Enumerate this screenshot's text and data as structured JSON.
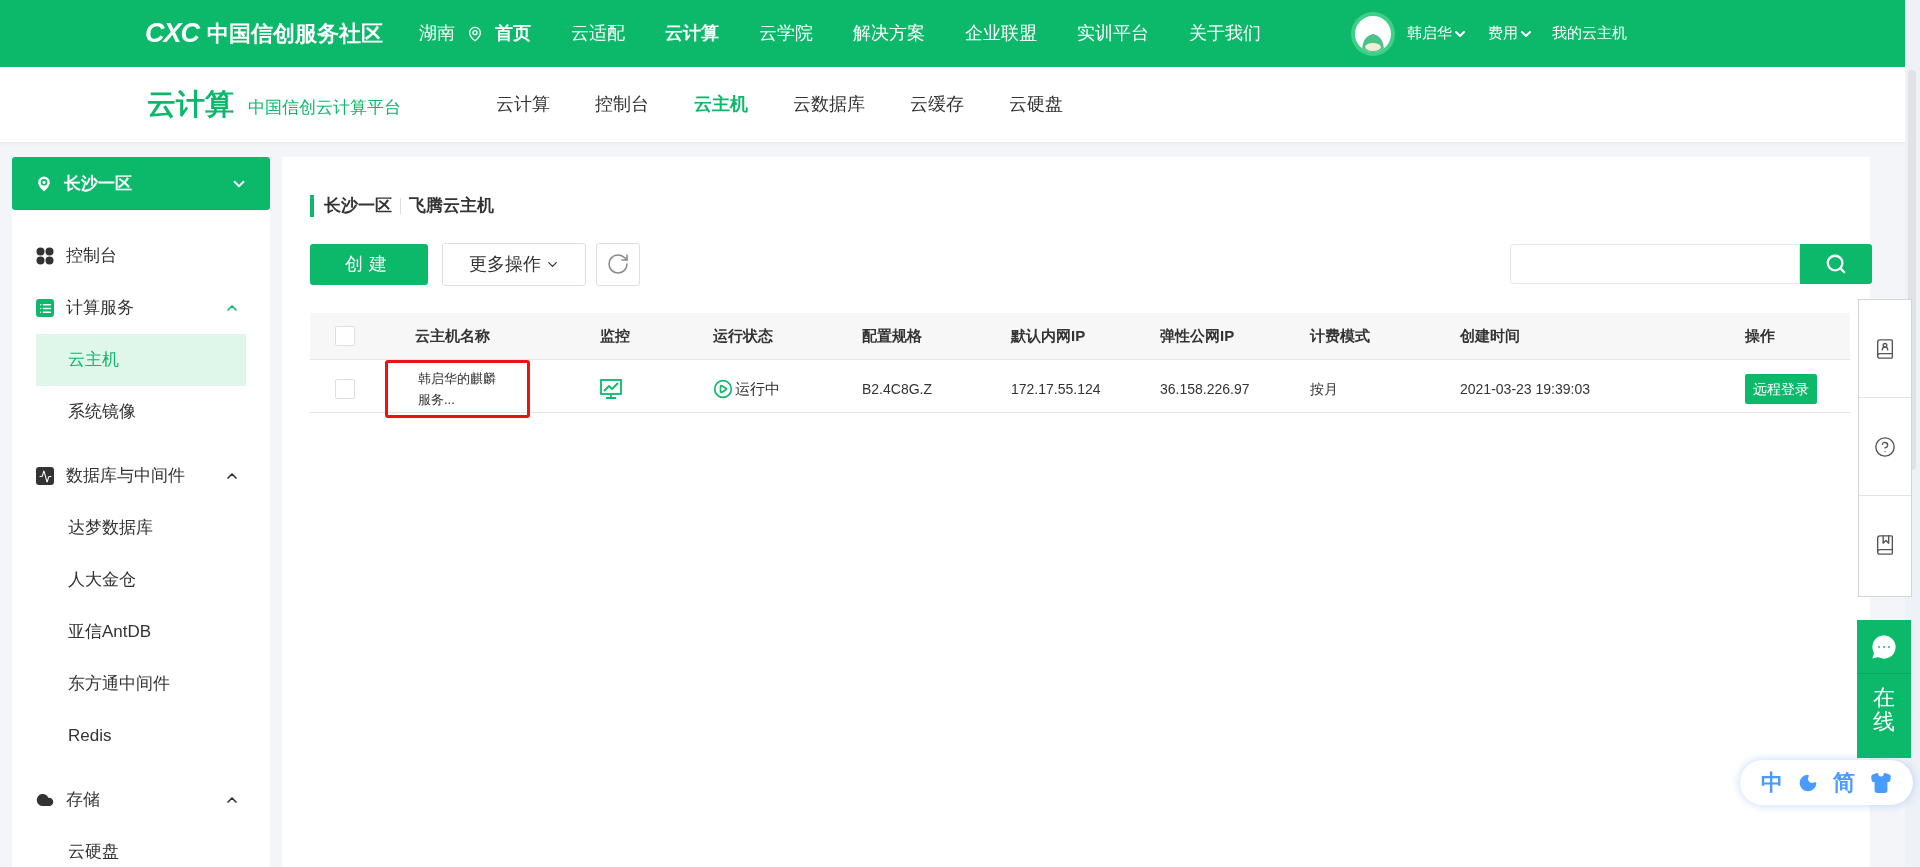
{
  "top_nav": {
    "logo_mark": "CXC",
    "logo_title": "中国信创服务社区",
    "region": "湖南",
    "items": [
      {
        "label": "首页",
        "bold": true
      },
      {
        "label": "云适配",
        "bold": false
      },
      {
        "label": "云计算",
        "bold": true
      },
      {
        "label": "云学院",
        "bold": false
      },
      {
        "label": "解决方案",
        "bold": false
      },
      {
        "label": "企业联盟",
        "bold": false
      },
      {
        "label": "实训平台",
        "bold": false
      },
      {
        "label": "关于我们",
        "bold": false
      }
    ],
    "user": {
      "name": "韩启华"
    },
    "menus": [
      "费用"
    ],
    "link": "我的云主机"
  },
  "sub_nav": {
    "title": "云计算",
    "subtitle": "中国信创云计算平台",
    "tabs": [
      {
        "label": "云计算",
        "selected": false
      },
      {
        "label": "控制台",
        "selected": false
      },
      {
        "label": "云主机",
        "selected": true
      },
      {
        "label": "云数据库",
        "selected": false
      },
      {
        "label": "云缓存",
        "selected": false
      },
      {
        "label": "云硬盘",
        "selected": false
      }
    ]
  },
  "sidebar": {
    "region": "长沙一区",
    "groups": [
      {
        "label": "控制台",
        "kind": "grid"
      },
      {
        "label": "计算服务",
        "kind": "list",
        "expanded": true,
        "children": [
          {
            "label": "云主机",
            "selected": true
          },
          {
            "label": "系统镜像",
            "selected": false
          }
        ]
      },
      {
        "label": "数据库与中间件",
        "kind": "pulse",
        "expanded": true,
        "children": [
          {
            "label": "达梦数据库",
            "selected": false
          },
          {
            "label": "人大金仓",
            "selected": false
          },
          {
            "label": "亚信AntDB",
            "selected": false
          },
          {
            "label": "东方通中间件",
            "selected": false
          },
          {
            "label": "Redis",
            "selected": false
          }
        ]
      },
      {
        "label": "存储",
        "kind": "cloud",
        "expanded": true,
        "children": [
          {
            "label": "云硬盘",
            "selected": false
          }
        ]
      }
    ]
  },
  "main": {
    "breadcrumb": [
      "长沙一区",
      "飞腾云主机"
    ],
    "create_button": "创建",
    "more_button": "更多操作",
    "table": {
      "select_all_checked": false,
      "columns": [
        "云主机名称",
        "监控",
        "运行状态",
        "配置规格",
        "默认内网IP",
        "弹性公网IP",
        "计费模式",
        "创建时间",
        "操作"
      ],
      "rows": [
        {
          "checked": false,
          "name": "韩启华的麒麟服务...",
          "highlighted": true,
          "status": {
            "kind": "running",
            "label": "运行中"
          },
          "spec": "B2.4C8G.Z",
          "private_ip": "172.17.55.124",
          "public_ip": "36.158.226.97",
          "billing": "按月",
          "created": "2021-03-23 19:39:03",
          "action": "远程登录"
        }
      ]
    }
  },
  "float": {
    "chat_label": "在线",
    "lang": [
      "中",
      "简"
    ]
  }
}
